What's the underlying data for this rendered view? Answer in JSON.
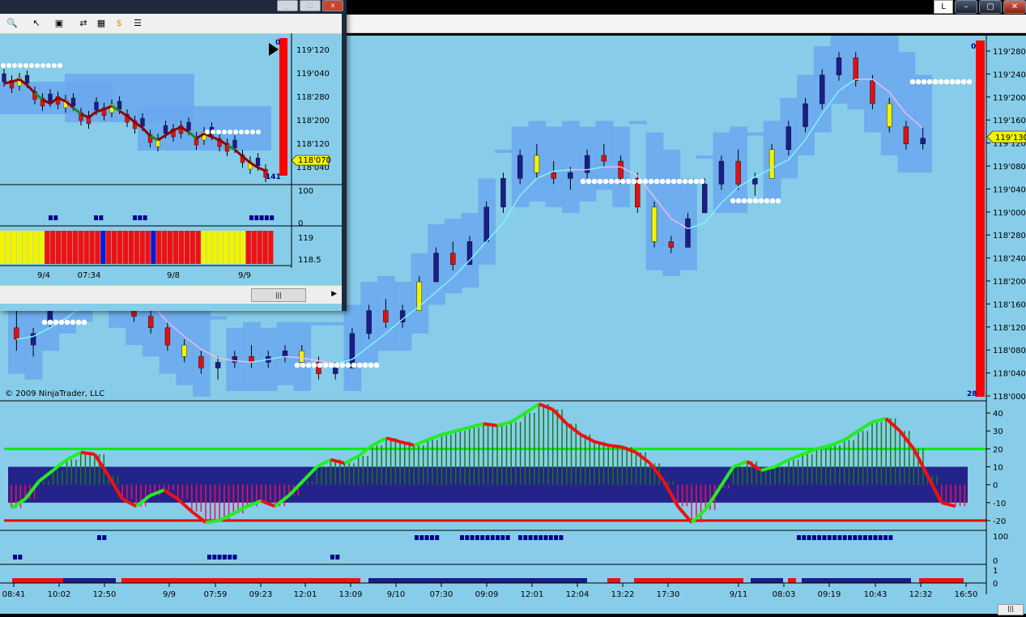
{
  "window": {
    "lang_button": "L",
    "minimize": "–",
    "maximize": "▢",
    "close": "✕"
  },
  "copyright": "© 2009 NinjaTrader, LLC",
  "price_axis": [
    "119'280",
    "119'240",
    "119'200",
    "119'160",
    "119'120",
    "119'080",
    "119'040",
    "119'000",
    "118'280",
    "118'240",
    "118'200",
    "118'160",
    "118'120",
    "118'080",
    "118'040",
    "118'000"
  ],
  "price_marker": "119'130",
  "bar_counter_top": "0",
  "bar_counter_bottom": "28",
  "osc_axis": [
    "40",
    "30",
    "20",
    "10",
    "0",
    "-10",
    "-20"
  ],
  "ind2_axis": [
    "100",
    "0"
  ],
  "ind3_axis": [
    "1",
    "0"
  ],
  "time_axis": [
    "08:41",
    "10:02",
    "12:50",
    "9/9",
    "07:59",
    "09:23",
    "12:01",
    "13:09",
    "9/10",
    "07:30",
    "09:09",
    "12:01",
    "12:04",
    "13:22",
    "17:30",
    "9/11",
    "08:03",
    "09:19",
    "10:43",
    "12:32",
    "16:50"
  ],
  "colors": {
    "background": "#87cde9",
    "band": "#6aa8ee",
    "bull": "#1c1c8a",
    "bear": "#dd1111",
    "neutral": "#f3f300",
    "up": "#22ee22",
    "down": "#ee1111",
    "zone": "#24238a"
  },
  "mini_chart": {
    "toolbar_icons": [
      "magnifier-icon",
      "cursor-icon",
      "zoom-box-icon",
      "data-box-icon",
      "chart-style-icon",
      "currency-icon",
      "properties-icon"
    ],
    "price_axis": [
      "119'120",
      "119'040",
      "118'280",
      "118'200",
      "118'120",
      "118'040"
    ],
    "price_marker": "118'070",
    "counter_top": "0",
    "counter_bottom": "141",
    "ind_axis": [
      "100",
      "0"
    ],
    "bar_axis": [
      "119",
      "118.5"
    ],
    "time_axis": [
      "9/4",
      "07:34",
      "9/8",
      "9/9"
    ],
    "scroll_thumb": "|||"
  },
  "chart_data": {
    "type": "candlestick",
    "ylim": [
      "118'000",
      "119'290"
    ],
    "ohlc_estimate": [
      [
        118.12,
        118.15,
        118.08,
        118.1
      ],
      [
        118.09,
        118.12,
        118.07,
        118.11
      ],
      [
        118.13,
        118.16,
        118.12,
        118.15
      ],
      [
        118.16,
        118.2,
        118.15,
        118.19
      ],
      [
        118.18,
        118.2,
        118.17,
        118.19
      ],
      [
        118.2,
        118.24,
        118.19,
        118.22
      ],
      [
        118.22,
        118.23,
        118.16,
        118.17
      ],
      [
        118.17,
        118.18,
        118.13,
        118.14
      ],
      [
        118.14,
        118.16,
        118.11,
        118.12
      ],
      [
        118.12,
        118.13,
        118.08,
        118.09
      ],
      [
        118.09,
        118.1,
        118.06,
        118.07
      ],
      [
        118.07,
        118.08,
        118.04,
        118.05
      ],
      [
        118.05,
        118.07,
        118.03,
        118.06
      ],
      [
        118.06,
        118.08,
        118.05,
        118.07
      ],
      [
        118.07,
        118.09,
        118.05,
        118.06
      ],
      [
        118.06,
        118.08,
        118.05,
        118.07
      ],
      [
        118.07,
        118.09,
        118.06,
        118.08
      ],
      [
        118.08,
        118.09,
        118.05,
        118.06
      ],
      [
        118.06,
        118.07,
        118.03,
        118.04
      ],
      [
        118.04,
        118.06,
        118.03,
        118.05
      ],
      [
        118.05,
        118.12,
        118.05,
        118.11
      ],
      [
        118.11,
        118.16,
        118.1,
        118.15
      ],
      [
        118.15,
        118.17,
        118.12,
        118.13
      ],
      [
        118.13,
        118.16,
        118.12,
        118.15
      ],
      [
        118.15,
        118.21,
        118.15,
        118.2
      ],
      [
        118.2,
        118.26,
        118.2,
        118.25
      ],
      [
        118.25,
        118.27,
        118.22,
        118.23
      ],
      [
        118.23,
        118.28,
        118.23,
        118.27
      ],
      [
        118.27,
        119.02,
        118.27,
        119.01
      ],
      [
        119.01,
        119.07,
        119.0,
        119.06
      ],
      [
        119.06,
        119.11,
        119.05,
        119.1
      ],
      [
        119.1,
        119.12,
        119.06,
        119.07
      ],
      [
        119.07,
        119.09,
        119.05,
        119.06
      ],
      [
        119.06,
        119.08,
        119.04,
        119.07
      ],
      [
        119.07,
        119.11,
        119.06,
        119.1
      ],
      [
        119.1,
        119.12,
        119.08,
        119.09
      ],
      [
        119.09,
        119.1,
        119.05,
        119.06
      ],
      [
        119.06,
        119.07,
        119.0,
        119.01
      ],
      [
        119.01,
        119.02,
        118.26,
        118.27
      ],
      [
        118.27,
        118.28,
        118.25,
        118.26
      ],
      [
        118.26,
        119.0,
        118.26,
        118.31
      ],
      [
        119.0,
        119.06,
        119.0,
        119.05
      ],
      [
        119.05,
        119.1,
        119.04,
        119.09
      ],
      [
        119.09,
        119.11,
        119.04,
        119.05
      ],
      [
        119.05,
        119.07,
        119.03,
        119.06
      ],
      [
        119.06,
        119.12,
        119.06,
        119.11
      ],
      [
        119.11,
        119.16,
        119.1,
        119.15
      ],
      [
        119.15,
        119.2,
        119.14,
        119.19
      ],
      [
        119.19,
        119.25,
        119.18,
        119.24
      ],
      [
        119.24,
        119.28,
        119.23,
        119.27
      ],
      [
        119.27,
        119.28,
        119.22,
        119.23
      ],
      [
        119.23,
        119.24,
        119.18,
        119.19
      ],
      [
        119.19,
        119.2,
        119.14,
        119.15
      ],
      [
        119.15,
        119.16,
        119.11,
        119.12
      ],
      [
        119.12,
        119.15,
        119.11,
        119.13
      ]
    ],
    "oscillator": {
      "levels": [
        20,
        -20
      ],
      "zone": [
        -10,
        10
      ],
      "values": [
        -13,
        -8,
        2,
        8,
        14,
        18,
        17,
        5,
        -8,
        -12,
        -6,
        -3,
        -8,
        -15,
        -21,
        -20,
        -16,
        -12,
        -9,
        -12,
        -6,
        2,
        10,
        14,
        12,
        16,
        22,
        26,
        24,
        22,
        25,
        28,
        30,
        32,
        34,
        33,
        35,
        40,
        45,
        42,
        34,
        28,
        24,
        22,
        21,
        18,
        12,
        2,
        -12,
        -21,
        -14,
        -2,
        10,
        13,
        8,
        10,
        14,
        17,
        20,
        22,
        25,
        30,
        35,
        37,
        30,
        20,
        5,
        -10,
        -12
      ]
    }
  }
}
